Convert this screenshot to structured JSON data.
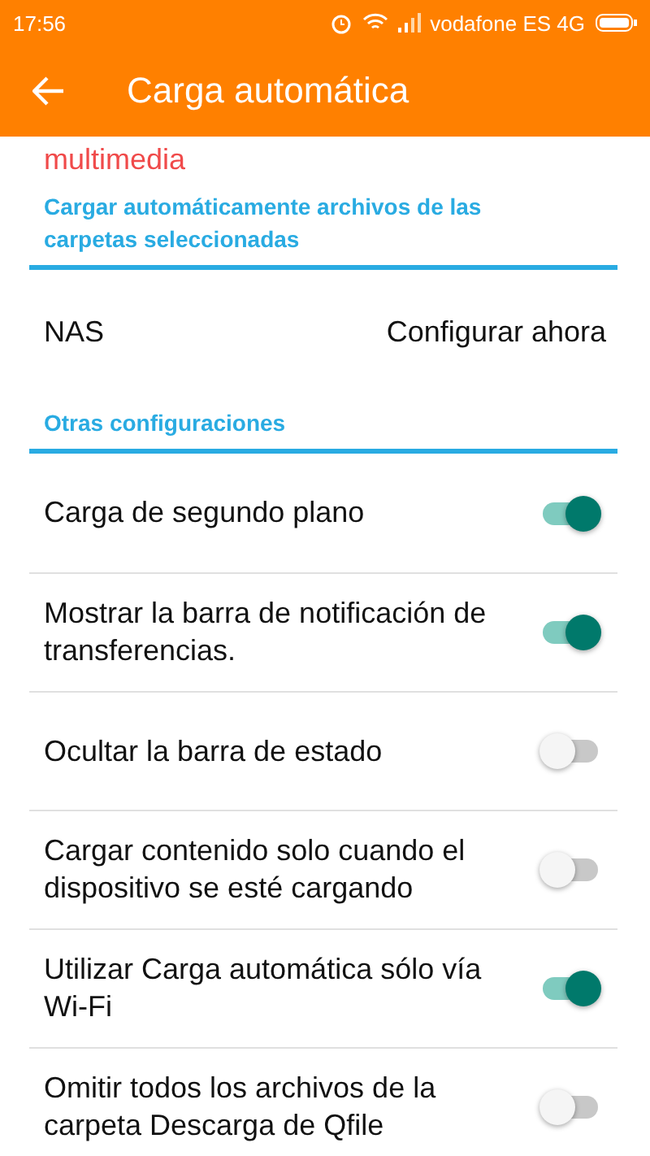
{
  "status_bar": {
    "time": "17:56",
    "carrier": "vodafone ES 4G"
  },
  "app_bar": {
    "title": "Carga automática"
  },
  "notice": "multimedia",
  "sections": [
    {
      "header": "Cargar automáticamente archivos de las carpetas seleccionadas",
      "items": [
        {
          "kind": "link",
          "label": "NAS",
          "action": "Configurar ahora"
        }
      ]
    },
    {
      "header": "Otras configuraciones",
      "items": [
        {
          "kind": "toggle",
          "label": "Carga de segundo plano",
          "on": true
        },
        {
          "kind": "toggle",
          "label": "Mostrar la barra de notificación de transferencias.",
          "on": true
        },
        {
          "kind": "toggle",
          "label": "Ocultar la barra de estado",
          "on": false
        },
        {
          "kind": "toggle",
          "label": "Cargar contenido solo cuando el dispositivo se esté cargando",
          "on": false
        },
        {
          "kind": "toggle",
          "label": "Utilizar Carga automática sólo vía Wi-Fi",
          "on": true
        },
        {
          "kind": "toggle",
          "label": "Omitir todos los archivos de la carpeta Descarga de Qfile",
          "on": false
        }
      ]
    }
  ]
}
